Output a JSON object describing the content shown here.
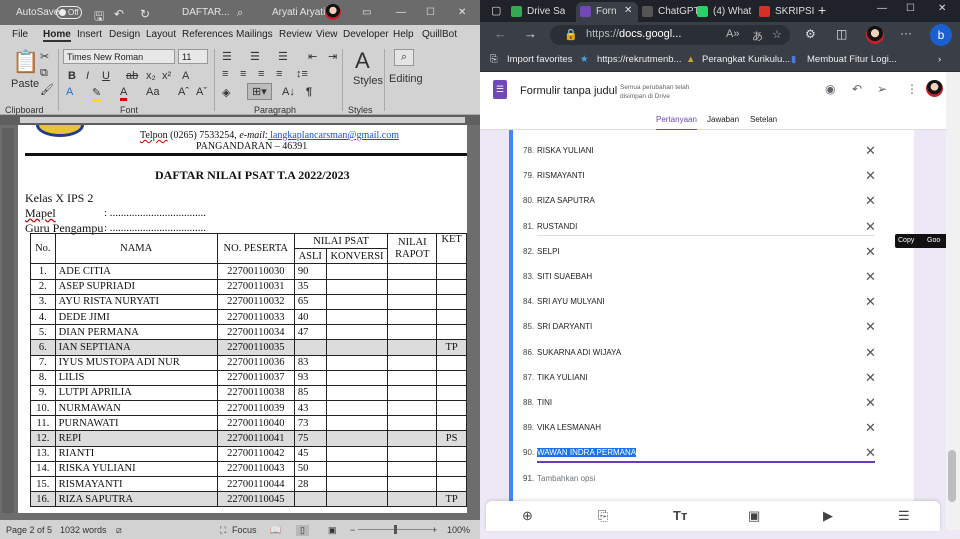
{
  "word": {
    "title": {
      "autosave": "AutoSave",
      "toggle": "Off",
      "doc": "DAFTAR...",
      "user": "Aryati Aryati"
    },
    "tabs": [
      "File",
      "Home",
      "Insert",
      "Design",
      "Layout",
      "References",
      "Mailings",
      "Review",
      "View",
      "Developer",
      "Help",
      "QuillBot"
    ],
    "ribbon": {
      "font_name": "Times New Roman",
      "font_size": "11",
      "paste": "Paste",
      "styles": "Styles",
      "editing": "Editing",
      "groups": [
        "Clipboard",
        "Font",
        "Paragraph",
        "Styles"
      ]
    },
    "doc": {
      "telpon_label": "Telpon",
      "telpon": " (0265) 7533254, ",
      "email_label": "e-mail",
      "email": " langkaplancarsman@gmail.com",
      "city": "PANGANDARAN – 46391",
      "title": "DAFTAR NILAI PSAT T.A 2022/2023",
      "kelas": "Kelas X IPS 2",
      "mapel_label": "Mapel",
      "mapel_value": ": ...................................",
      "guru_label": "Guru Pengampu",
      "guru_value": ": ...................................",
      "headers": {
        "no": "No.",
        "nama": "NAMA",
        "peserta": "NO. PESERTA",
        "psat": "NILAI PSAT",
        "asli": "ASLI",
        "konversi": "KONVERSI",
        "rapot1": "NILAI",
        "rapot2": "RAPOT",
        "ket": "KET"
      },
      "rows": [
        {
          "no": "1.",
          "nama": "ADE CITIA",
          "peserta": "22700110030",
          "asli": "90",
          "ket": ""
        },
        {
          "no": "2.",
          "nama": "ASEP SUPRIADI",
          "peserta": "22700110031",
          "asli": "35",
          "ket": ""
        },
        {
          "no": "3.",
          "nama": "AYU RISTA NURYATI",
          "peserta": "22700110032",
          "asli": "65",
          "ket": ""
        },
        {
          "no": "4.",
          "nama": "DEDE JIMI",
          "peserta": "22700110033",
          "asli": "40",
          "ket": ""
        },
        {
          "no": "5.",
          "nama": "DIAN PERMANA",
          "peserta": "22700110034",
          "asli": "47",
          "ket": ""
        },
        {
          "no": "6.",
          "nama": "IAN SEPTIANA",
          "peserta": "22700110035",
          "asli": "",
          "ket": "TP",
          "grey": true
        },
        {
          "no": "7.",
          "nama": "IYUS MUSTOPA ADI NUR",
          "peserta": "22700110036",
          "asli": "83",
          "ket": ""
        },
        {
          "no": "8.",
          "nama": "LILIS",
          "peserta": "22700110037",
          "asli": "93",
          "ket": ""
        },
        {
          "no": "9.",
          "nama": "LUTPI APRILIA",
          "peserta": "22700110038",
          "asli": "85",
          "ket": ""
        },
        {
          "no": "10.",
          "nama": "NURMAWAN",
          "peserta": "22700110039",
          "asli": "43",
          "ket": ""
        },
        {
          "no": "11.",
          "nama": "PURNAWATI",
          "peserta": "22700110040",
          "asli": "73",
          "ket": ""
        },
        {
          "no": "12.",
          "nama": "REPI",
          "peserta": "22700110041",
          "asli": "75",
          "ket": "PS",
          "grey": true
        },
        {
          "no": "13.",
          "nama": "RIANTI",
          "peserta": "22700110042",
          "asli": "45",
          "ket": ""
        },
        {
          "no": "14.",
          "nama": "RISKA YULIANI",
          "peserta": "22700110043",
          "asli": "50",
          "ket": ""
        },
        {
          "no": "15.",
          "nama": "RISMAYANTI",
          "peserta": "22700110044",
          "asli": "28",
          "ket": ""
        },
        {
          "no": "16.",
          "nama": "RIZA SAPUTRA",
          "peserta": "22700110045",
          "asli": "",
          "ket": "TP",
          "grey": true
        }
      ]
    },
    "status": {
      "page": "Page 2 of 5",
      "words": "1032 words",
      "focus": "Focus",
      "zoom": "100%",
      "zoom_fraction": 0.5
    }
  },
  "edge": {
    "tabs": [
      {
        "label": "Drive Sa",
        "color": "#34a853"
      },
      {
        "label": "Forn",
        "color": "#7248b9"
      },
      {
        "label": "ChatGPT",
        "color": "#555"
      },
      {
        "label": "(4) What",
        "color": "#25d366"
      },
      {
        "label": "SKRIPSI",
        "color": "#d93025"
      }
    ],
    "url_prefix": "https://",
    "url_host": "docs.googl...",
    "favorites": [
      "Import favorites",
      "https://rekrutmenb...",
      "Perangkat Kurikulu...",
      "Membuat Fitur Logi..."
    ],
    "forms": {
      "title": "Formulir tanpa judul",
      "saved": "Semua perubahan telah disimpan di Drive",
      "tabs": [
        "Pertanyaan",
        "Jawaban",
        "Setelan"
      ],
      "options": [
        {
          "n": "78.",
          "v": "RISKA YULIANI"
        },
        {
          "n": "79.",
          "v": "RISMAYANTI"
        },
        {
          "n": "80.",
          "v": "RIZA SAPUTRA"
        },
        {
          "n": "81.",
          "v": "RUSTANDI"
        },
        {
          "n": "82.",
          "v": "SELPI"
        },
        {
          "n": "83.",
          "v": "SITI SUAEBAH"
        },
        {
          "n": "84.",
          "v": "SRI AYU  MULYANI"
        },
        {
          "n": "85.",
          "v": "SRI DARYANTI"
        },
        {
          "n": "86.",
          "v": "SUKARNA ADI WIJAYA"
        },
        {
          "n": "87.",
          "v": "TIKA YULIANI"
        },
        {
          "n": "88.",
          "v": "TINI"
        },
        {
          "n": "89.",
          "v": "VIKA LESMANAH"
        },
        {
          "n": "90.",
          "v": "WAWAN INDRA PERMANA",
          "selected": true
        }
      ],
      "add": {
        "n": "91.",
        "v": "Tambahkan opsi"
      },
      "popup": {
        "copy": "Copy",
        "search": "Goo"
      }
    }
  }
}
